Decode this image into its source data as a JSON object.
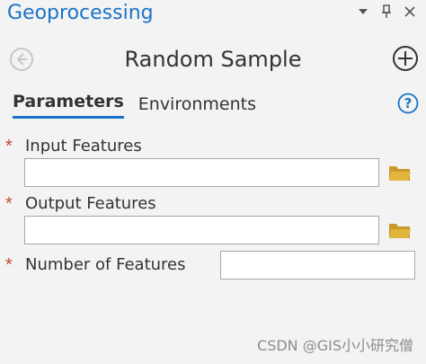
{
  "pane": {
    "title": "Geoprocessing",
    "controls": [
      "dropdown-icon",
      "pin-icon",
      "close-icon"
    ]
  },
  "tool": {
    "title": "Random Sample",
    "back_icon": "back-arrow-icon",
    "add_icon": "add-circle-icon"
  },
  "tabs": {
    "parameters": "Parameters",
    "environments": "Environments",
    "active": "Parameters",
    "help_icon": "help-icon"
  },
  "parameters": [
    {
      "label": "Input Features",
      "required": true,
      "value": "",
      "browse_icon": "folder-icon"
    },
    {
      "label": "Output Features",
      "required": true,
      "value": "",
      "browse_icon": "folder-icon"
    },
    {
      "label": "Number of Features",
      "required": true,
      "value": ""
    }
  ],
  "required_marker": "*",
  "watermark": "CSDN @GIS小小研究僧",
  "colors": {
    "accent": "#1a73c8",
    "required": "#c44b2d",
    "folder": "#e2b53c",
    "background": "#f3f3f3"
  }
}
